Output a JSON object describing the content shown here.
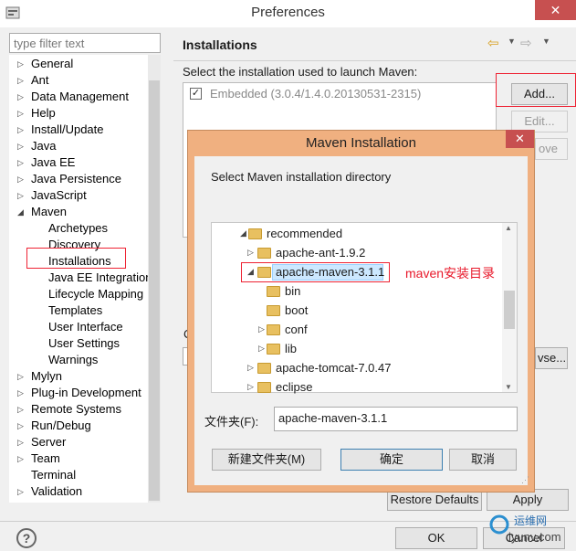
{
  "window": {
    "title": "Preferences",
    "close_label": "✕"
  },
  "filter": {
    "placeholder": "type filter text"
  },
  "tree": [
    {
      "label": "General",
      "twisty": "▷"
    },
    {
      "label": "Ant",
      "twisty": "▷"
    },
    {
      "label": "Data Management",
      "twisty": "▷"
    },
    {
      "label": "Help",
      "twisty": "▷"
    },
    {
      "label": "Install/Update",
      "twisty": "▷"
    },
    {
      "label": "Java",
      "twisty": "▷"
    },
    {
      "label": "Java EE",
      "twisty": "▷"
    },
    {
      "label": "Java Persistence",
      "twisty": "▷"
    },
    {
      "label": "JavaScript",
      "twisty": "▷"
    },
    {
      "label": "Maven",
      "twisty": "◢"
    },
    {
      "label": "Archetypes",
      "twisty": ""
    },
    {
      "label": "Discovery",
      "twisty": ""
    },
    {
      "label": "Installations",
      "twisty": ""
    },
    {
      "label": "Java EE Integration",
      "twisty": ""
    },
    {
      "label": "Lifecycle Mapping",
      "twisty": ""
    },
    {
      "label": "Templates",
      "twisty": ""
    },
    {
      "label": "User Interface",
      "twisty": ""
    },
    {
      "label": "User Settings",
      "twisty": ""
    },
    {
      "label": "Warnings",
      "twisty": ""
    },
    {
      "label": "Mylyn",
      "twisty": "▷"
    },
    {
      "label": "Plug-in Development",
      "twisty": "▷"
    },
    {
      "label": "Remote Systems",
      "twisty": "▷"
    },
    {
      "label": "Run/Debug",
      "twisty": "▷"
    },
    {
      "label": "Server",
      "twisty": "▷"
    },
    {
      "label": "Team",
      "twisty": "▷"
    },
    {
      "label": "Terminal",
      "twisty": ""
    },
    {
      "label": "Validation",
      "twisty": "▷"
    }
  ],
  "page": {
    "title": "Installations",
    "select_label": "Select the installation used to launch Maven:",
    "installation": "Embedded (3.0.4/1.4.0.20130531-2315)",
    "installation_checked": "✓",
    "add_label": "Add...",
    "edit_label": "Edit...",
    "remove_label": "ove",
    "browse_label": "vse...",
    "c_label": "C",
    "restore_label": "Restore Defaults",
    "apply_label": "Apply"
  },
  "footer": {
    "ok_label": "OK",
    "cancel_label": "Cancel",
    "help_icon": "?"
  },
  "dialog": {
    "title": "Maven Installation",
    "close_label": "✕",
    "instruction": "Select Maven installation directory",
    "folders": [
      {
        "label": "recommended",
        "expander": "◢"
      },
      {
        "label": "apache-ant-1.9.2",
        "expander": "▷"
      },
      {
        "label": "apache-maven-3.1.1",
        "expander": "◢"
      },
      {
        "label": "bin",
        "expander": ""
      },
      {
        "label": "boot",
        "expander": ""
      },
      {
        "label": "conf",
        "expander": "▷"
      },
      {
        "label": "lib",
        "expander": "▷"
      },
      {
        "label": "apache-tomcat-7.0.47",
        "expander": "▷"
      },
      {
        "label": "eclipse",
        "expander": "▷"
      }
    ],
    "annotation": "maven安装目录",
    "folder_label": "文件夹(F):",
    "folder_value": "apache-maven-3.1.1",
    "new_folder_label": "新建文件夹(M)",
    "ok_label": "确定",
    "cancel_label": "取消"
  },
  "watermark": {
    "site": "iyunv.com",
    "cn": "运维网"
  },
  "colors": {
    "highlight_red": "#e23030",
    "dialog_frame": "#f0b080",
    "close_red": "#c75050"
  }
}
